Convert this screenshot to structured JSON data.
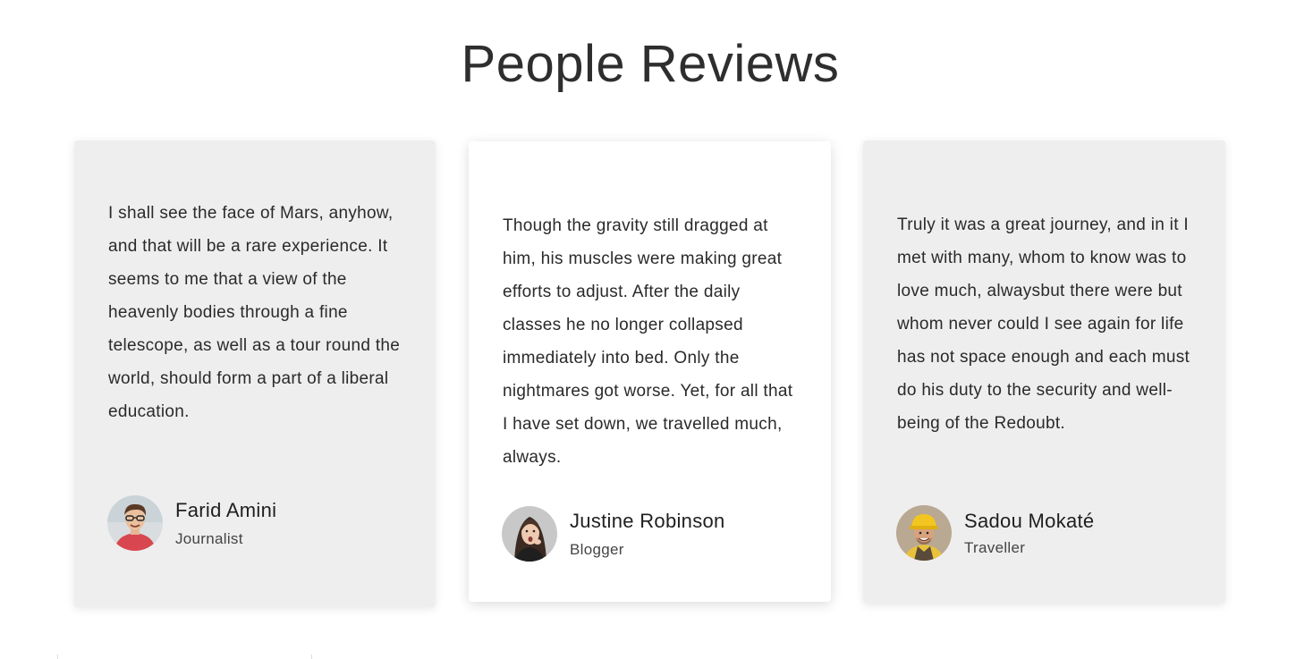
{
  "section": {
    "title": "People Reviews"
  },
  "reviews": [
    {
      "quote": "I shall see the face of Mars, anyhow, and that will be a rare experience. It seems to me that a view of the heavenly bodies through a fine telescope, as well as a tour round the world, should form a part of a liberal education.",
      "name": "Farid Amini",
      "role": "Journalist",
      "avatar": "avatar-man-glasses-red-shirt"
    },
    {
      "quote": "Though the gravity still dragged at him, his muscles were making great efforts to adjust. After the daily classes he no longer collapsed immediately into bed. Only the nightmares got worse. Yet, for all that I have set down, we travelled much, always.",
      "name": "Justine Robinson",
      "role": "Blogger",
      "avatar": "avatar-woman-surprised"
    },
    {
      "quote": "Truly it was a great journey, and in it I met with many, whom to know was to love much, alwaysbut there were but whom never could I see again for life has not space enough and each must do his duty to the security and well-being of the Redoubt.",
      "name": "Sadou Mokaté",
      "role": "Traveller",
      "avatar": "avatar-man-hard-hat"
    }
  ],
  "colors": {
    "card_bg": "#eeeeee",
    "card_active_bg": "#ffffff",
    "title": "#2e2e2e",
    "text": "#2a2a2a"
  }
}
